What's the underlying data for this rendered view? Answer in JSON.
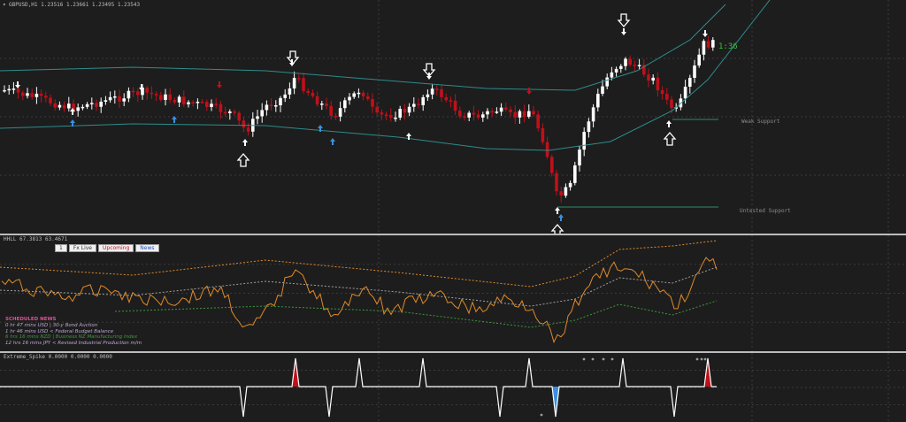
{
  "main_chart": {
    "title": "GBPUSD,H1  1.23516 1.23661 1.23495 1.23543",
    "timer_label": "1:36",
    "weak_support_label": "Weak Support",
    "untested_support_label": "Untested Support"
  },
  "indicator1": {
    "title": "HHLL 67.3813 63.4671",
    "tabs": [
      "1",
      "Fx Live",
      "Upcoming",
      "News"
    ],
    "news_heading": "SCHEDULED NEWS",
    "news_lines": [
      {
        "text": "0 hr 47 mins  USD  |  30-y Bond Auction",
        "color": "#bfa9d4"
      },
      {
        "text": "1 hr 46 mins  USD  <  Federal Budget Balance",
        "color": "#bfa9d4"
      },
      {
        "text": "6 hrs 16 mins  NZD  |  Business NZ Manufacturing Index",
        "color": "#3c9a3c"
      },
      {
        "text": "12 hrs 16 mins  JPY  <  Revised Industrial Production m/m",
        "color": "#bfa9d4"
      }
    ]
  },
  "indicator2": {
    "title": "Extreme_Spike 0.0000 0.0000 0.0000"
  },
  "colors": {
    "background": "#1d1d1d",
    "grid": "#3a3a3a",
    "bull_candle": "#ffffff",
    "bear_candle": "#c0101a",
    "channel": "#2f8c8c",
    "oscillator": "#e08a2a",
    "signal_line": "#3c9a3c",
    "timer": "#35c435",
    "spike_up": "#c0101a",
    "spike_down": "#3a8fe0"
  },
  "icons": {
    "sell_arrow": "down-arrow-icon",
    "buy_arrow": "up-arrow-icon",
    "menu": "dropdown-triangle-icon"
  }
}
